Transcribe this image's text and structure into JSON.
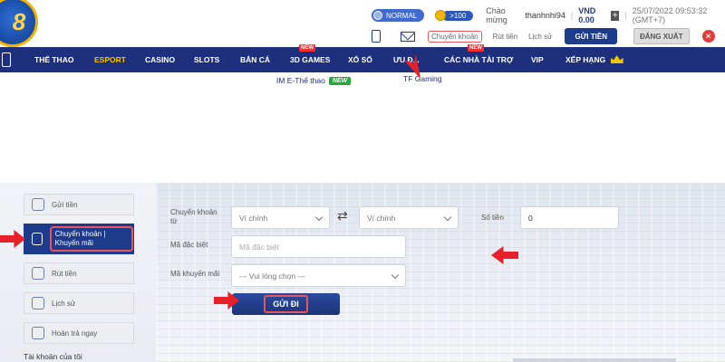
{
  "brand": {
    "logo_text": "8"
  },
  "header": {
    "level_badge": "NORMAL",
    "points_badge": ">100",
    "welcome_text": "Chào mừng",
    "username": "thanhnhi94",
    "balance": "VND 0.00",
    "datetime": "25/07/2022 09:53:32 (GMT+7)",
    "actions": {
      "transfer_link": "Chuyển khoản",
      "withdraw_link": "Rút tiền",
      "history_link": "Lịch sử",
      "deposit_button": "GỬI TIỀN",
      "logout_button": "ĐĂNG XUẤT"
    }
  },
  "nav": {
    "items": [
      {
        "label": "THỂ THAO"
      },
      {
        "label": "ESPORT",
        "active": true
      },
      {
        "label": "CASINO"
      },
      {
        "label": "SLOTS"
      },
      {
        "label": "BẮN CÁ"
      },
      {
        "label": "3D GAMES",
        "tag": "NEW"
      },
      {
        "label": "XỔ SỐ"
      },
      {
        "label": "ƯU Đ..."
      },
      {
        "label": "CÁC NHÀ TÀI TRỢ",
        "tag": "NEW"
      },
      {
        "label": "VIP"
      },
      {
        "label": "XẾP HẠNG"
      }
    ],
    "sub_items": [
      {
        "label": "IM E-Thể thao",
        "tag": "NEW"
      },
      {
        "label": "TF Gaming"
      }
    ]
  },
  "sidebar": {
    "items": [
      {
        "label": "Gửi tiền"
      },
      {
        "label": "Chuyển khoản | Khuyến mãi",
        "active": true
      },
      {
        "label": "Rút tiền"
      },
      {
        "label": "Lịch sử"
      },
      {
        "label": "Hoàn trả ngay"
      }
    ],
    "section_title": "Tài khoản của tôi"
  },
  "form": {
    "transfer_from_label": "Chuyển khoản từ",
    "from_wallet": "Ví chính",
    "to_wallet": "Ví chính",
    "amount_label": "Số tiền",
    "amount_value": "0",
    "special_code_label": "Mã đặc biệt",
    "special_code_placeholder": "Mã đặc biệt",
    "promo_code_label": "Mã khuyến mãi",
    "promo_code_value": "--- Vui lòng chọn ---",
    "submit_button": "GỬI ĐI"
  },
  "colors": {
    "nav_background": "#1e2f7d",
    "nav_active": "#f5c400",
    "primary_button": "#1e3a8a",
    "highlight_annotation": "#e8202a"
  }
}
